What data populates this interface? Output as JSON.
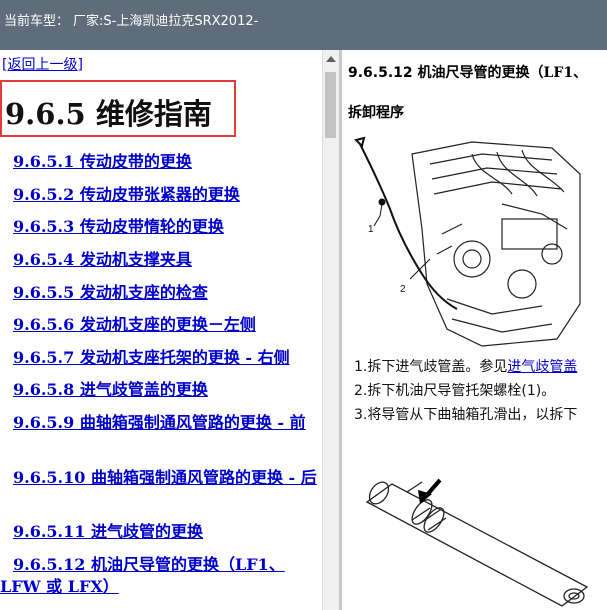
{
  "header": {
    "label": "当前车型：",
    "model": "厂家:S-上海凯迪拉克SRX2012-"
  },
  "left": {
    "back_link": "[返回上一级]",
    "section_title": "9.6.5 维修指南",
    "toc": [
      "9.6.5.1 传动皮带的更换",
      "9.6.5.2 传动皮带张紧器的更换",
      "9.6.5.3 传动皮带惰轮的更换",
      "9.6.5.4 发动机支撑夹具",
      "9.6.5.5 发动机支座的检查",
      "9.6.5.6 发动机支座的更换－左侧",
      "9.6.5.7 发动机支座托架的更换 - 右侧",
      "9.6.5.8 进气歧管盖的更换",
      "9.6.5.9 曲轴箱强制通风管路的更换 - 前",
      "9.6.5.10 曲轴箱强制通风管路的更换 - 后",
      "9.6.5.11 进气歧管的更换",
      "9.6.5.12 机油尺导管的更换（LF1、LFW 或 LFX）"
    ]
  },
  "right": {
    "title_prefix": "9.6.5.12",
    "title_text": "机油尺导管的更换（LF1、",
    "procedure_heading": "拆卸程序",
    "figure1_callouts": [
      "1",
      "2"
    ],
    "steps": [
      {
        "text": "1.拆下进气歧管盖。参见",
        "link": "进气歧管盖"
      },
      {
        "text": "2.拆下机油尺导管托架螺栓",
        "tail": "(1)。"
      },
      {
        "text": "3.将导管从下曲轴箱孔滑出，以拆下",
        "tail": ""
      }
    ]
  }
}
